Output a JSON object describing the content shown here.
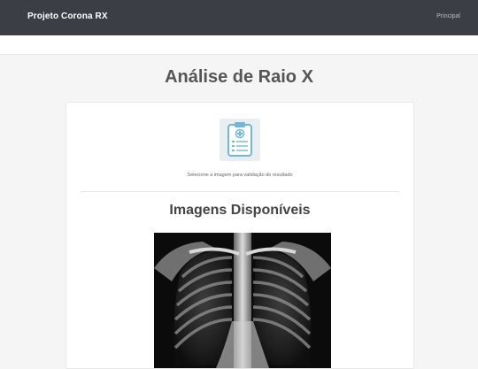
{
  "navbar": {
    "brand": "Projeto Corona RX",
    "links": [
      "Principal"
    ]
  },
  "page": {
    "title": "Análise de Raio X"
  },
  "upload": {
    "icon": "clipboard-medical-icon",
    "helper_text": "Selecione a imagem para validação do resultado"
  },
  "gallery": {
    "title": "Imagens Disponíveis",
    "image": "chest-xray-image"
  },
  "colors": {
    "navbar": "#3b3e45",
    "background": "#f5f5f5",
    "icon_accent": "#6fb9d8"
  }
}
